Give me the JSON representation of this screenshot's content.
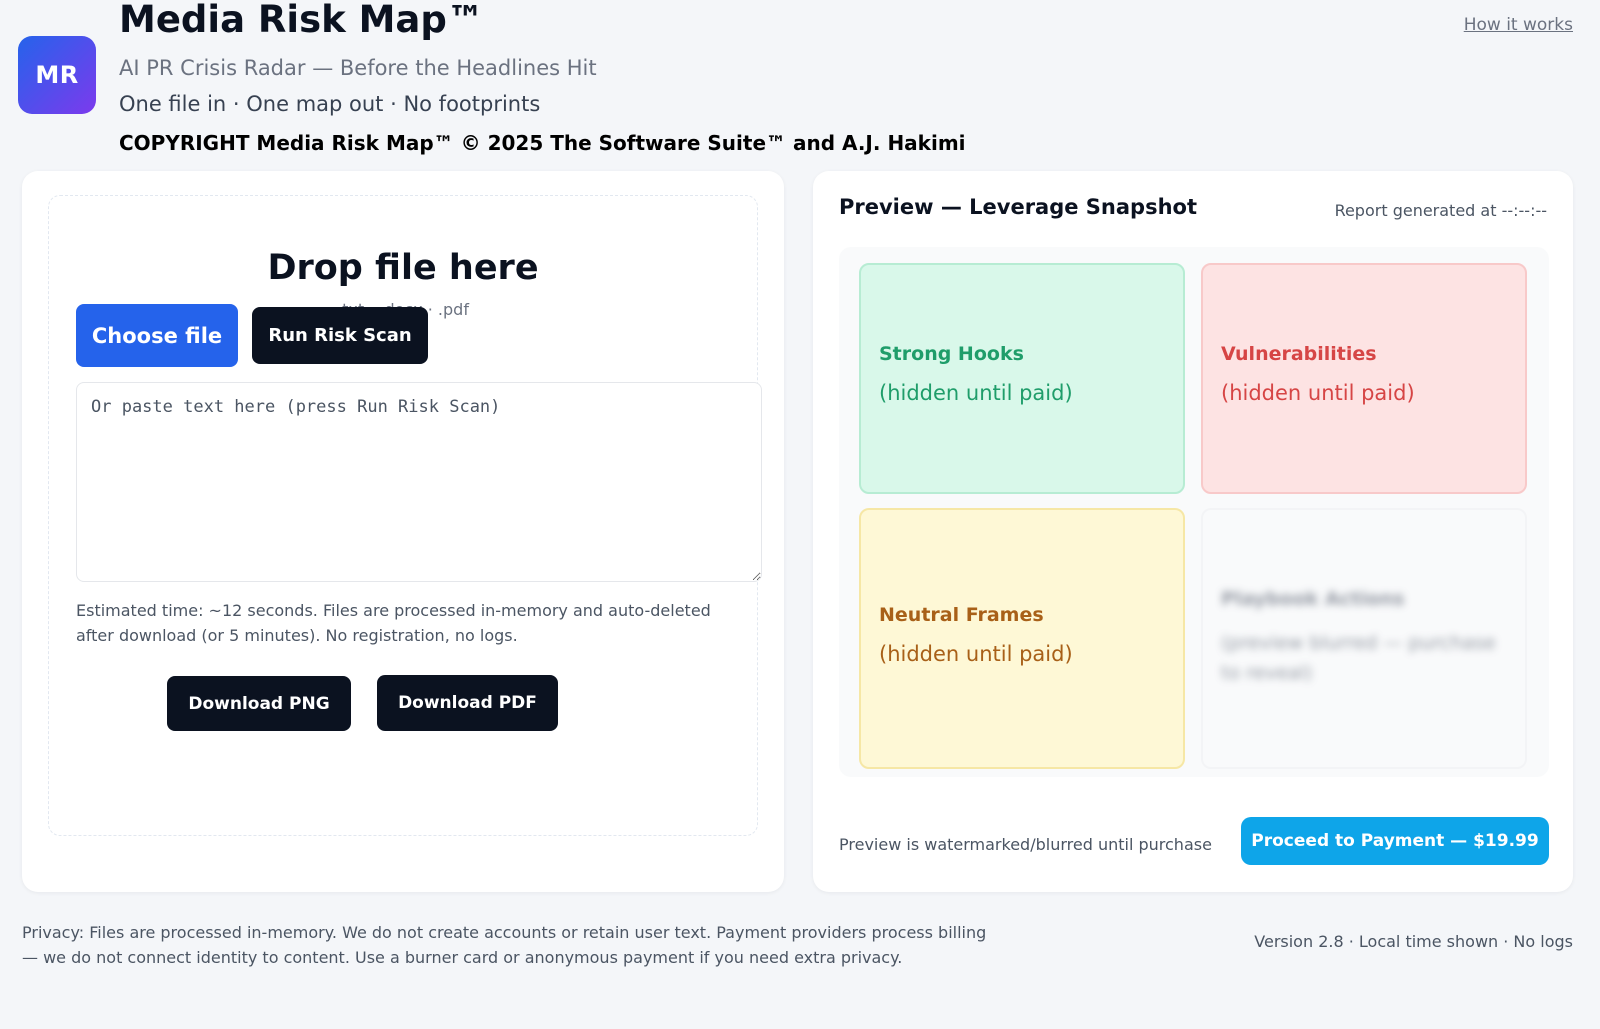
{
  "header": {
    "logo_text": "MR",
    "title": "Media Risk Map™",
    "subtitle": "AI PR Crisis Radar — Before the Headlines Hit",
    "tagline": "One file in · One map out · No footprints",
    "copyright": "COPYRIGHT Media Risk Map™ © 2025 The Software Suite™ and A.J. Hakimi",
    "how_it_works_link": "How it works"
  },
  "upload": {
    "drop_title": "Drop file here",
    "file_types": ".txt · .docx · .pdf",
    "choose_file_label": "Choose file",
    "run_scan_label": "Run Risk Scan",
    "paste_placeholder": "Or paste text here (press Run Risk Scan)",
    "paste_value": "",
    "estimate_note": "Estimated time: ~12 seconds. Files are processed in-memory and auto-deleted after download (or 5 minutes). No registration, no logs.",
    "download_png_label": "Download PNG",
    "download_pdf_label": "Download PDF"
  },
  "preview": {
    "title": "Preview — Leverage Snapshot",
    "report_time": "Report generated at --:--:--",
    "quadrants": [
      {
        "label": "Strong Hooks",
        "note": "(hidden until paid)",
        "color": "#1f9d6a"
      },
      {
        "label": "Vulnerabilities",
        "note": "(hidden until paid)",
        "color": "#d64545"
      },
      {
        "label": "Neutral Frames",
        "note": "(hidden until paid)",
        "color": "#a86018"
      },
      {
        "label": "Playbook Actions",
        "note": "(preview blurred — purchase to reveal)",
        "color": "#6b7280"
      }
    ],
    "watermark_note": "Preview is watermarked/blurred until purchase",
    "pay_button_label": "Proceed to Payment — $19.99"
  },
  "footer": {
    "privacy": "Privacy: Files are processed in-memory. We do not create accounts or retain user text. Payment providers process billing — we do not connect identity to content. Use a burner card or anonymous payment if you need extra privacy.",
    "version": "Version 2.8 · Local time shown · No logs"
  },
  "colors": {
    "primary_blue": "#2563eb",
    "dark_button": "#0b1220",
    "pay_button": "#0ea5e9",
    "page_background": "#f4f6f9"
  }
}
